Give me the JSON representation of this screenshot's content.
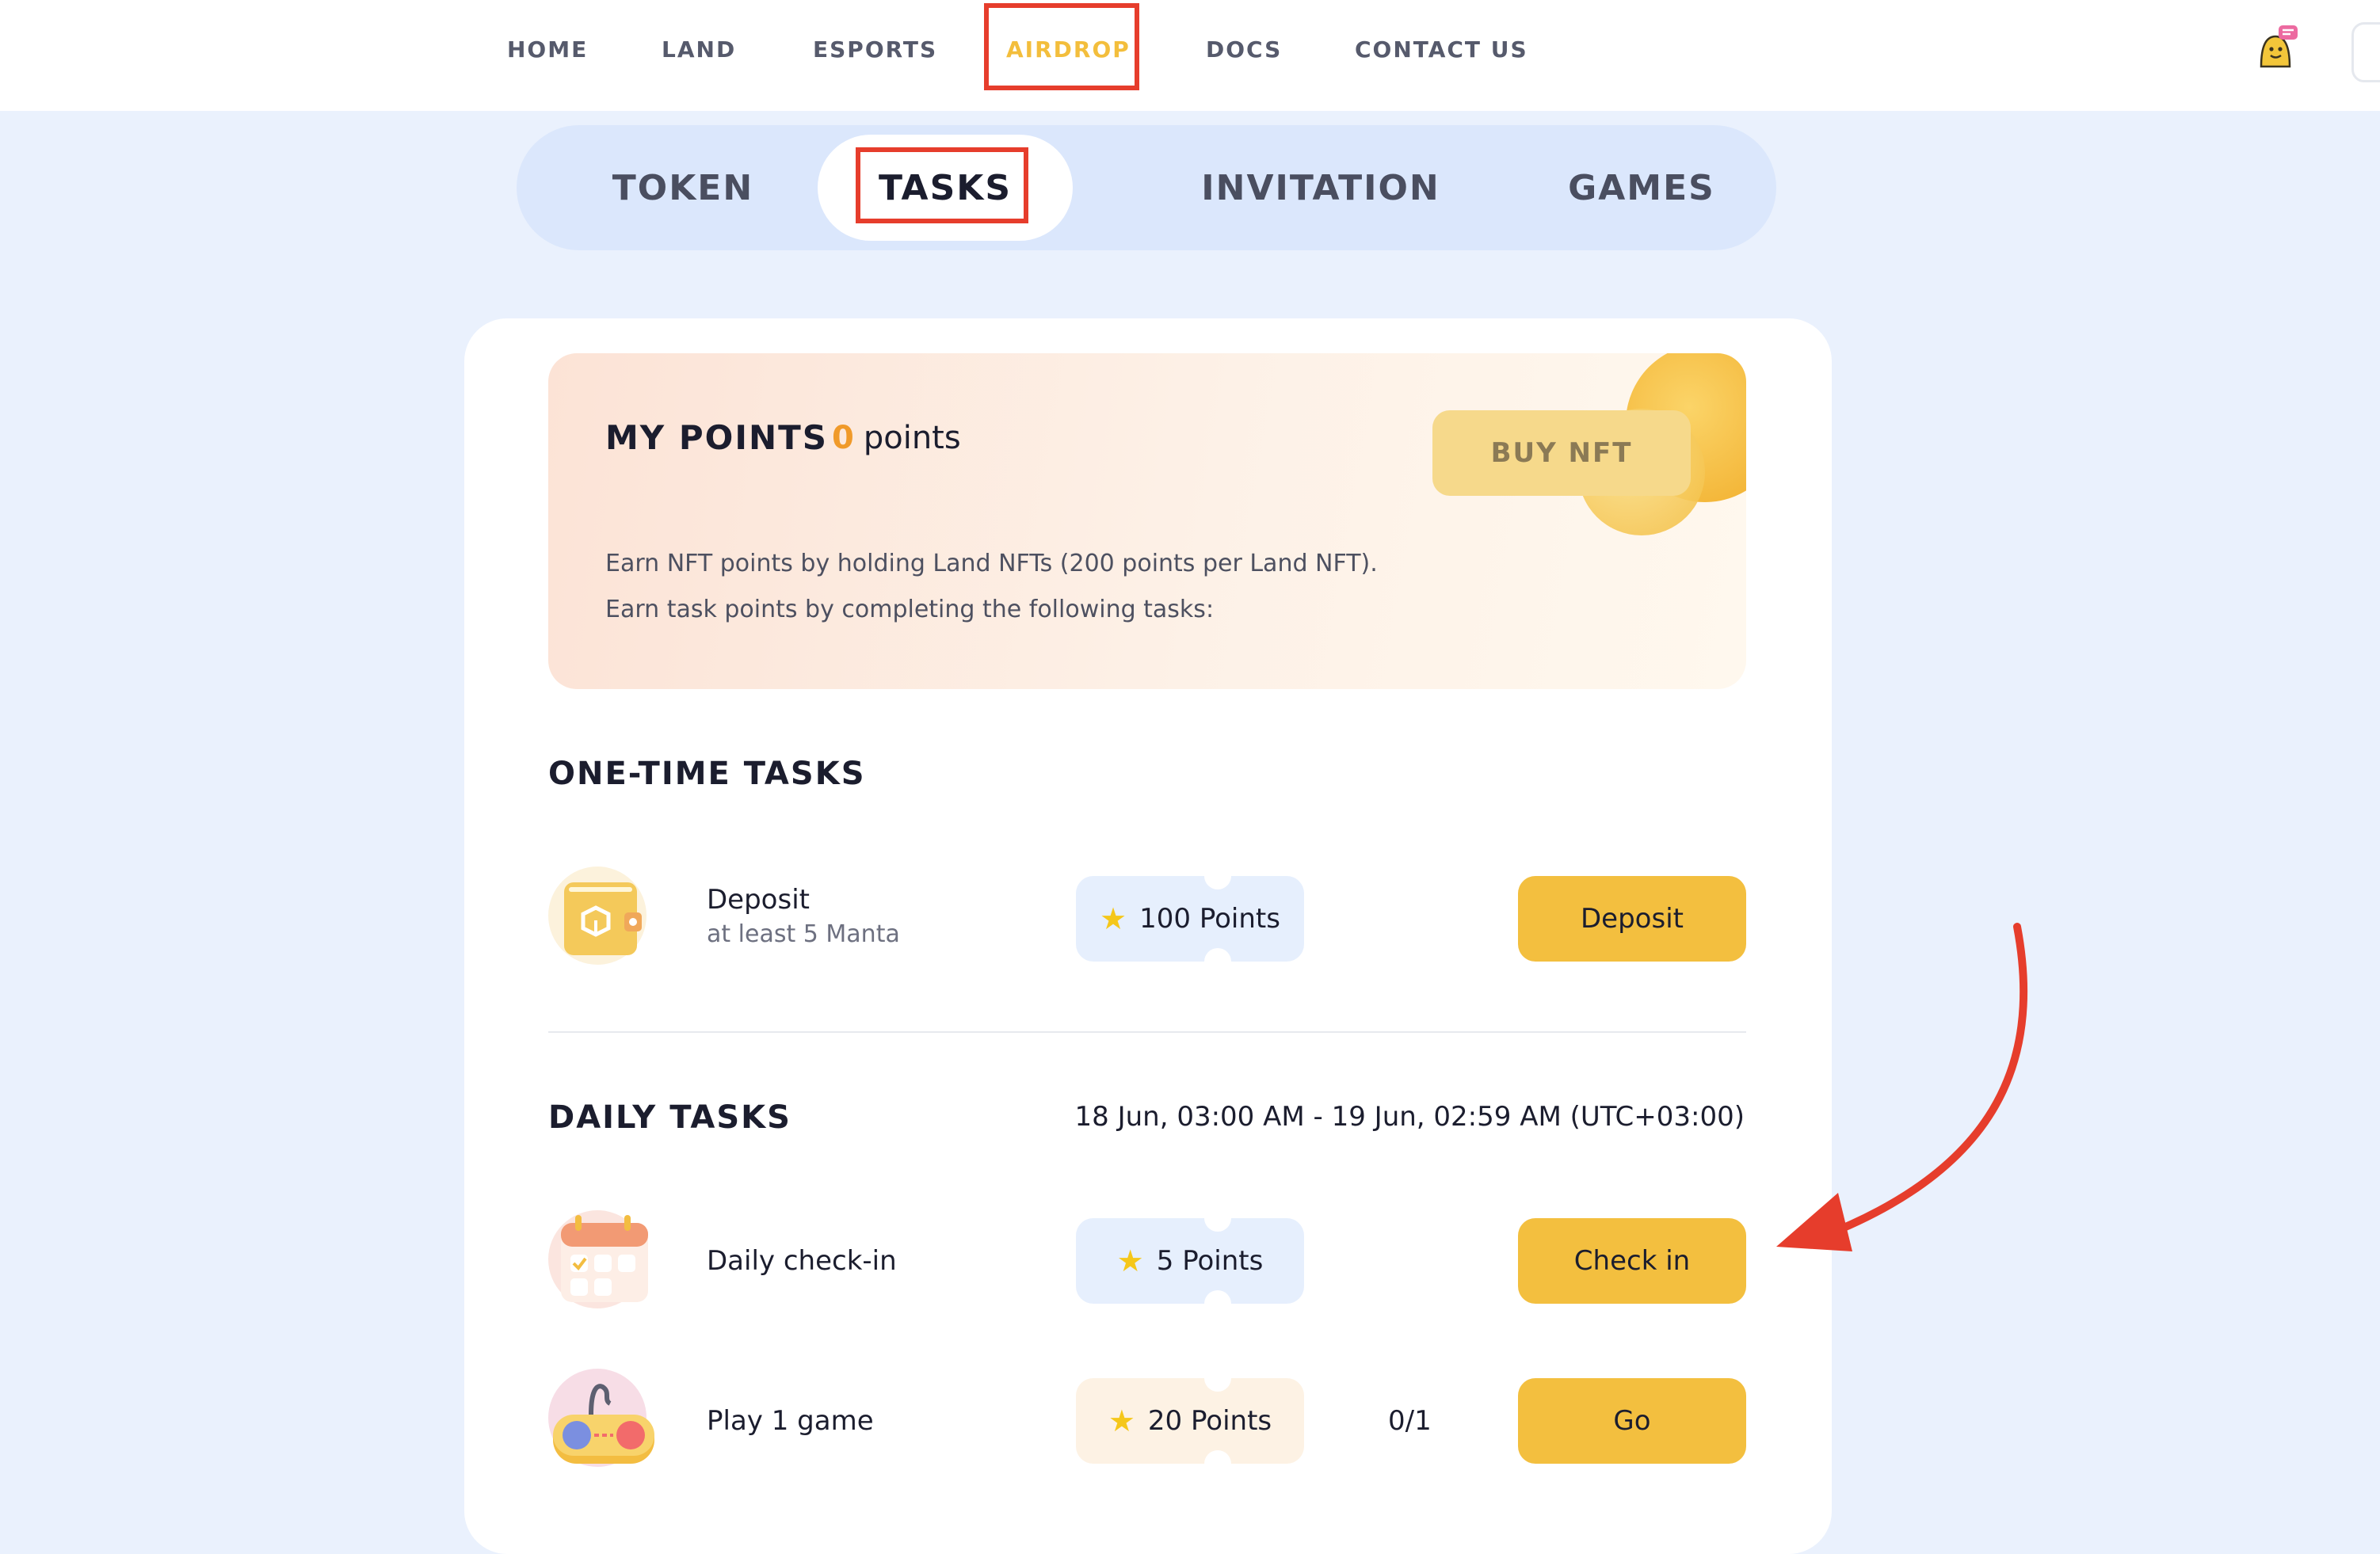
{
  "nav": {
    "items": [
      "HOME",
      "LAND",
      "ESPORTS",
      "AIRDROP",
      "DOCS",
      "CONTACT US"
    ],
    "active": "AIRDROP"
  },
  "subtabs": {
    "items": [
      "TOKEN",
      "TASKS",
      "INVITATION",
      "GAMES"
    ],
    "active": "TASKS"
  },
  "points_card": {
    "title": "MY POINTS",
    "value": "0",
    "unit": "points",
    "buy_label": "BUY NFT",
    "desc_1": "Earn NFT points by holding Land NFTs (200 points per Land NFT).",
    "desc_2": "Earn task points by completing the following tasks:"
  },
  "one_time": {
    "title": "ONE-TIME TASKS",
    "tasks": [
      {
        "icon": "wallet-icon",
        "name": "Deposit",
        "sub": "at least 5 Manta",
        "points": "100 Points",
        "action": "Deposit"
      }
    ]
  },
  "daily": {
    "title": "DAILY TASKS",
    "date_range": "18 Jun, 03:00 AM - 19 Jun, 02:59 AM (UTC+03:00)",
    "tasks": [
      {
        "icon": "calendar-icon",
        "name": "Daily check-in",
        "points": "5 Points",
        "action": "Check in"
      },
      {
        "icon": "gamepad-icon",
        "name": "Play 1 game",
        "points": "20 Points",
        "progress": "0/1",
        "action": "Go"
      }
    ]
  },
  "colors": {
    "accent": "#f3bf3f",
    "active_nav": "#f3be3c",
    "highlight": "#e63d2c",
    "background": "#eaf1fd"
  }
}
